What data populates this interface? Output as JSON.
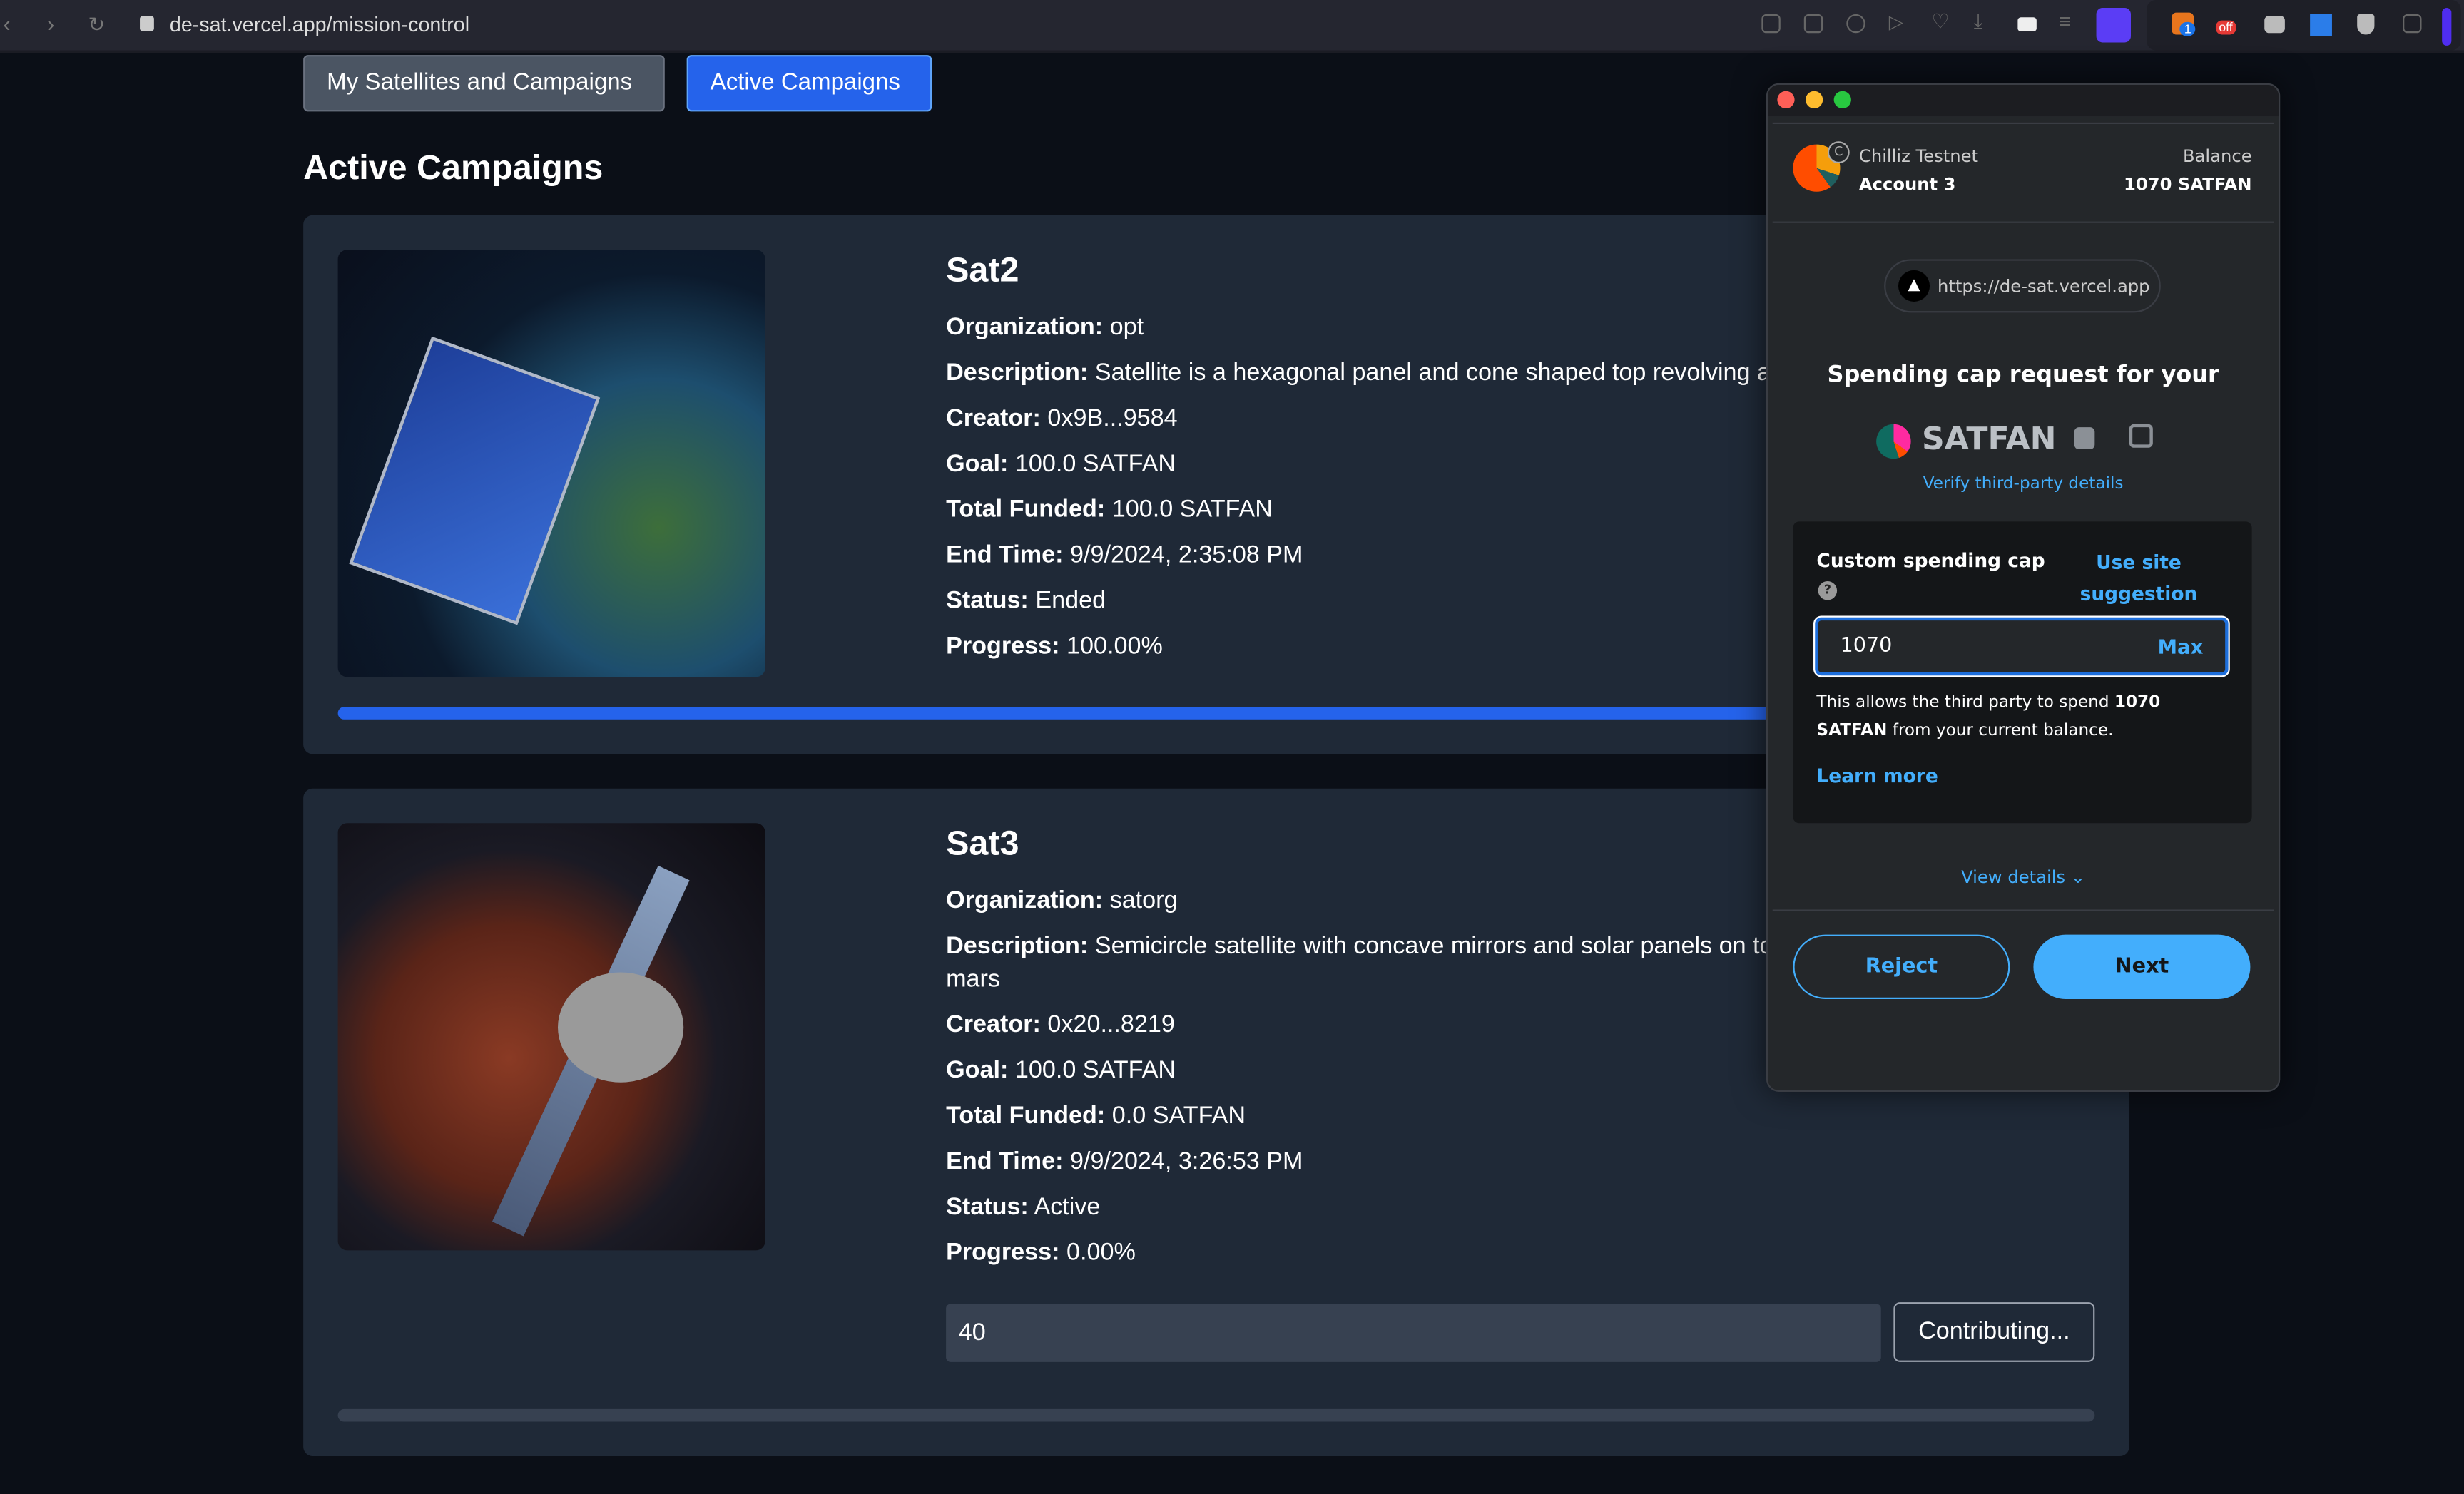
{
  "browser": {
    "url": "de-sat.vercel.app/mission-control",
    "extension_badge_1": "1",
    "extension_badge_2": "off"
  },
  "tabs": [
    {
      "label": "My Satellites and Campaigns",
      "active": false
    },
    {
      "label": "Active Campaigns",
      "active": true
    }
  ],
  "page_title": "Active Campaigns",
  "labels": {
    "organization": "Organization:",
    "description": "Description:",
    "creator": "Creator:",
    "goal": "Goal:",
    "total_funded": "Total Funded:",
    "end_time": "End Time:",
    "status": "Status:",
    "progress": "Progress:"
  },
  "campaigns": [
    {
      "name": "Sat2",
      "organization": "opt",
      "description": "Satellite is a hexagonal panel and cone shaped top revolving around earth",
      "creator": "0x9B...9584",
      "goal": "100.0 SATFAN",
      "total_funded": "100.0 SATFAN",
      "end_time": "9/9/2024, 2:35:08 PM",
      "status": "Ended",
      "progress": "100.00%",
      "progress_value": 100
    },
    {
      "name": "Sat3",
      "organization": "satorg",
      "description": "Semicircle satellite with concave mirrors and solar panels on top of cylindrical body revolving mars",
      "creator": "0x20...8219",
      "goal": "100.0 SATFAN",
      "total_funded": "0.0 SATFAN",
      "end_time": "9/9/2024, 3:26:53 PM",
      "status": "Active",
      "progress": "0.00%",
      "progress_value": 0,
      "contribution_input": "40",
      "contribute_button": "Contributing..."
    }
  ],
  "wallet": {
    "network": "Chilliz Testnet",
    "account": "Account 3",
    "balance_label": "Balance",
    "balance": "1070 SATFAN",
    "origin": "https://de-sat.vercel.app",
    "title": "Spending cap request for your",
    "token": "SATFAN",
    "verify_link": "Verify third-party details",
    "custom_cap_label": "Custom spending cap",
    "use_site_suggestion": "Use site suggestion",
    "cap_value": "1070",
    "max_label": "Max",
    "allow_text_pre": "This allows the third party to spend ",
    "allow_text_bold": "1070 SATFAN",
    "allow_text_post": " from your current balance.",
    "learn_more": "Learn more",
    "view_details": "View details",
    "reject": "Reject",
    "next": "Next"
  },
  "colors": {
    "accent": "#2563eb",
    "wallet_accent": "#43aefc",
    "card_bg": "#1f2937",
    "page_bg": "#0b0f17"
  }
}
